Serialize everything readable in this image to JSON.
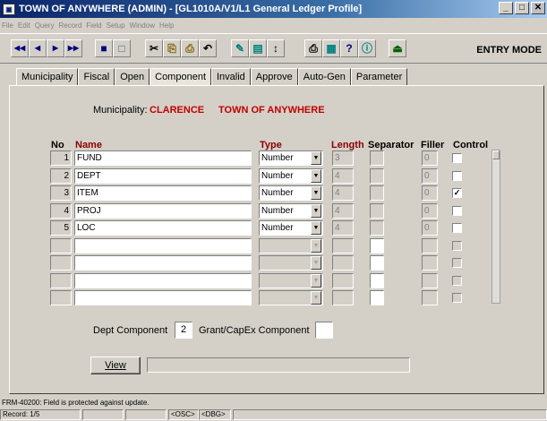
{
  "window": {
    "title": "TOWN OF ANYWHERE (ADMIN) - [GL1010A/V1/L1 General Ledger Profile]",
    "buttons": [
      "_",
      "□",
      "✕"
    ]
  },
  "menu": [
    "File",
    "Edit",
    "Query",
    "Record",
    "Field",
    "Setup",
    "Window",
    "Help"
  ],
  "toolbar": {
    "mode": "ENTRY MODE",
    "buttons": [
      {
        "name": "first-record-button",
        "glyph": "◀◀"
      },
      {
        "name": "prev-record-button",
        "glyph": "◀"
      },
      {
        "name": "next-record-button",
        "glyph": "▶"
      },
      {
        "name": "last-record-button",
        "glyph": "▶▶"
      },
      {
        "name": "save-button",
        "glyph": "■"
      },
      {
        "name": "new-record-button",
        "glyph": "□"
      },
      {
        "name": "cut-button",
        "glyph": "✂"
      },
      {
        "name": "copy-button",
        "glyph": "⎘"
      },
      {
        "name": "paste-button",
        "glyph": "⎙"
      },
      {
        "name": "undo-button",
        "glyph": "↶"
      },
      {
        "name": "edit-button",
        "glyph": "✎"
      },
      {
        "name": "list-button",
        "glyph": "▤"
      },
      {
        "name": "sort-button",
        "glyph": "↕"
      },
      {
        "name": "print-button",
        "glyph": "⎙"
      },
      {
        "name": "calculator-button",
        "glyph": "▦"
      },
      {
        "name": "help-button",
        "glyph": "?"
      },
      {
        "name": "info-button",
        "glyph": "ⓘ"
      },
      {
        "name": "exit-button",
        "glyph": "⏏"
      }
    ]
  },
  "tabs": [
    "Municipality",
    "Fiscal",
    "Open",
    "Component",
    "Invalid",
    "Approve",
    "Auto-Gen",
    "Parameter"
  ],
  "active_tab": "Component",
  "municipality": {
    "label": "Municipality:",
    "code": "CLARENCE",
    "name": "TOWN OF ANYWHERE"
  },
  "columns": {
    "no": "No",
    "name": "Name",
    "type": "Type",
    "length": "Length",
    "separator": "Separator",
    "filler": "Filler",
    "control": "Control"
  },
  "rows": [
    {
      "no": "1",
      "name": "FUND",
      "type": "Number",
      "length": "3",
      "separator": "",
      "filler": "0",
      "control": false
    },
    {
      "no": "2",
      "name": "DEPT",
      "type": "Number",
      "length": "4",
      "separator": "",
      "filler": "0",
      "control": false
    },
    {
      "no": "3",
      "name": "ITEM",
      "type": "Number",
      "length": "4",
      "separator": "",
      "filler": "0",
      "control": true
    },
    {
      "no": "4",
      "name": "PROJ",
      "type": "Number",
      "length": "4",
      "separator": "",
      "filler": "0",
      "control": false
    },
    {
      "no": "5",
      "name": "LOC",
      "type": "Number",
      "length": "4",
      "separator": "",
      "filler": "0",
      "control": false
    },
    {
      "no": "",
      "name": "",
      "type": "",
      "length": "",
      "separator": "",
      "filler": "",
      "control": false
    },
    {
      "no": "",
      "name": "",
      "type": "",
      "length": "",
      "separator": "",
      "filler": "",
      "control": false
    },
    {
      "no": "",
      "name": "",
      "type": "",
      "length": "",
      "separator": "",
      "filler": "",
      "control": false
    },
    {
      "no": "",
      "name": "",
      "type": "",
      "length": "",
      "separator": "",
      "filler": "",
      "control": false
    }
  ],
  "dept_component": {
    "label": "Dept Component",
    "value": "2"
  },
  "grant_component": {
    "label": "Grant/CapEx Component",
    "value": ""
  },
  "view_button": "View",
  "status": {
    "message": "FRM-40200: Field is protected against update.",
    "record": "Record: 1/5",
    "osc": "<OSC>",
    "dbg": "<DBG>"
  }
}
